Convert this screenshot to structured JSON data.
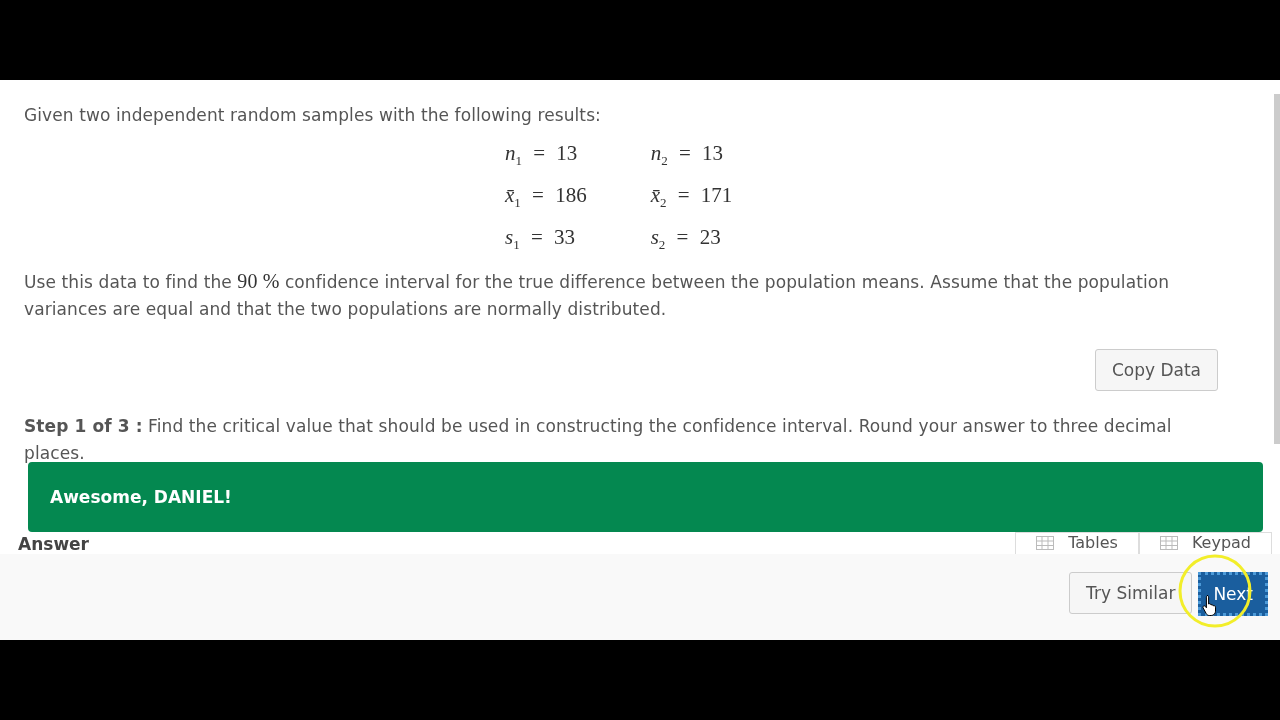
{
  "question": {
    "intro": "Given two independent random samples with the following results:",
    "samples": [
      {
        "n": "*n*$_{1}$ = 13",
        "mean": "*x̄*$_{1}$ = 186",
        "sd": "*s*$_{1}$ = 33"
      },
      {
        "n": "*n*$_{2}$ = 13",
        "mean": "*x̄*$_{2}$ = 171",
        "sd": "*s*$_{2}$ = 23"
      }
    ],
    "instruction": "Use this data to find the *90 %* confidence interval for the true difference between the population means.  Assume that the population variances are equal and that the two populations are normally distributed.",
    "copy_button": "Copy Data",
    "step": "**Step 1 of 3 :** Find the critical value that should be used in constructing the confidence interval. Round your answer to three decimal places."
  },
  "answer": {
    "label": "Answer",
    "tools": [
      "Tables",
      "Keypad"
    ]
  },
  "toast": {
    "message": "Awesome, DANIEL!"
  },
  "buttons": {
    "try_similar": "Try Similar",
    "next": "Next"
  }
}
